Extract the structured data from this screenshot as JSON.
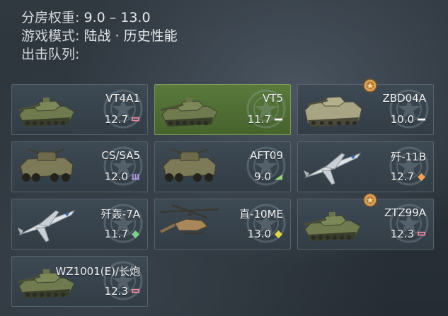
{
  "header": {
    "br_label": "分房权重:",
    "br_value": "9.0 – 13.0",
    "mode_label": "游戏模式:",
    "mode_value": "陆战 · 历史性能",
    "lineup_label": "出击队列:"
  },
  "vehicles": [
    {
      "name": "VT4A1",
      "br": "12.7",
      "type": "tank",
      "role_icon": "heavy-tank-icon",
      "role_color": "#e88aa0"
    },
    {
      "name": "VT5",
      "br": "11.7",
      "type": "light-tank",
      "role_icon": "light-tank-icon",
      "role_color": "#ffffff"
    },
    {
      "name": "ZBD04A",
      "br": "10.0",
      "type": "ifv",
      "role_icon": "light-tank-icon",
      "role_color": "#ffffff"
    },
    {
      "name": "CS/SA5",
      "br": "12.0",
      "type": "spaa",
      "role_icon": "spaa-icon",
      "role_color": "#b29ae6"
    },
    {
      "name": "AFT09",
      "br": "9.0",
      "type": "tank-destroyer",
      "role_icon": "tank-destroyer-icon",
      "role_color": "#9ed67a"
    },
    {
      "name": "歼-11B",
      "br": "12.7",
      "type": "fighter",
      "role_icon": "fighter-icon",
      "role_color": "#f0a050"
    },
    {
      "name": "歼轰-7A",
      "br": "11.7",
      "type": "strike-aircraft",
      "role_icon": "strike-aircraft-icon",
      "role_color": "#7ad08a"
    },
    {
      "name": "直-10ME",
      "br": "13.0",
      "type": "helicopter",
      "role_icon": "helicopter-icon",
      "role_color": "#e6d640"
    },
    {
      "name": "ZTZ99A",
      "br": "12.3",
      "type": "tank",
      "role_icon": "heavy-tank-icon",
      "role_color": "#e88aa0"
    },
    {
      "name": "WZ1001(E)/长炮",
      "br": "12.3",
      "type": "tank",
      "role_icon": "heavy-tank-icon",
      "role_color": "#e88aa0"
    }
  ],
  "selected_index": 1,
  "medal_indices": [
    2,
    8
  ],
  "colors": {
    "card_bg": "#3a4650",
    "card_selected_bg": "#507035",
    "card_border": "#56636d",
    "medal_gold": "#d9a35a"
  }
}
